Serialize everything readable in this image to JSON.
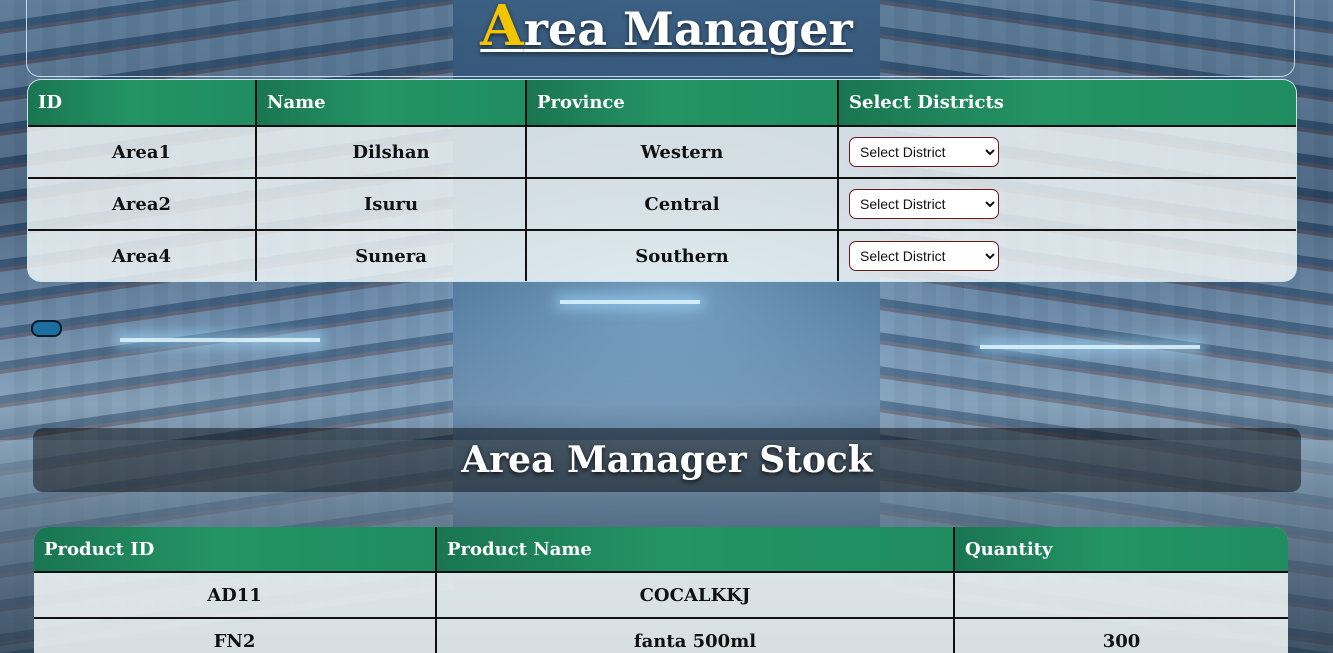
{
  "header": {
    "title_first_letter": "A",
    "title_rest": "rea Manager"
  },
  "area_table": {
    "columns": [
      "ID",
      "Name",
      "Province",
      "Select Districts"
    ],
    "rows": [
      {
        "id": "Area1",
        "name": "Dilshan",
        "province": "Western",
        "district": "Select District"
      },
      {
        "id": "Area2",
        "name": "Isuru",
        "province": "Central",
        "district": "Select District"
      },
      {
        "id": "Area4",
        "name": "Sunera",
        "province": "Southern",
        "district": "Select District"
      }
    ]
  },
  "stock_section": {
    "title": "Area Manager Stock"
  },
  "stock_table": {
    "columns": [
      "Product ID",
      "Product Name",
      "Quantity"
    ],
    "rows": [
      {
        "product_id": "AD11",
        "product_name": "COCALKKJ",
        "quantity": ""
      },
      {
        "product_id": "FN2",
        "product_name": "fanta 500ml",
        "quantity": "300"
      }
    ]
  },
  "colors": {
    "header_green": "#249464",
    "title_accent": "#f2c500",
    "toggle_blue": "#1a6ea0"
  }
}
